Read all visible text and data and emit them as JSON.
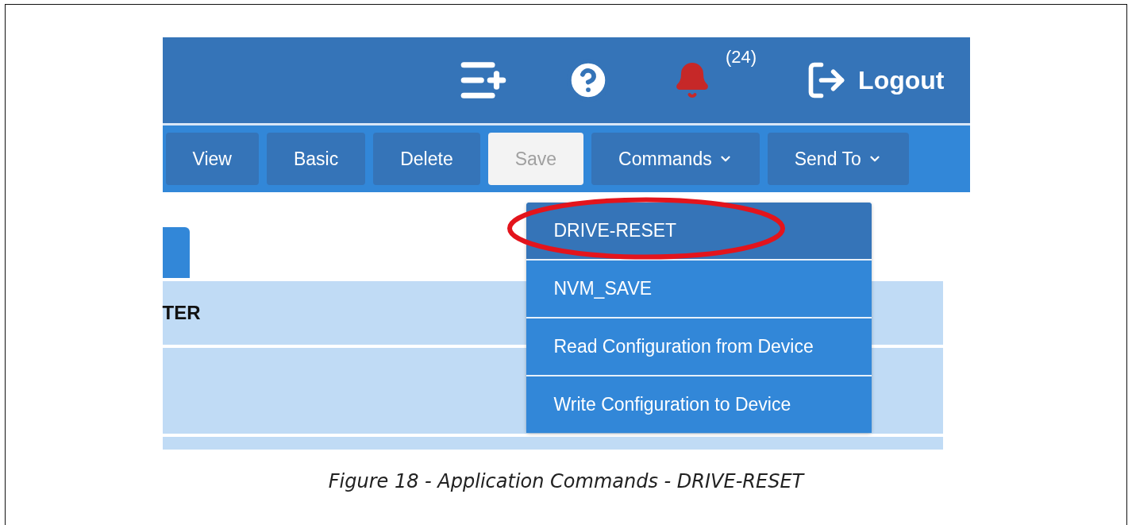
{
  "header": {
    "notification_count": "(24)",
    "logout": "Logout"
  },
  "toolbar": [
    {
      "label": "View",
      "disabled": false,
      "dropdown": false
    },
    {
      "label": "Basic",
      "disabled": false,
      "dropdown": false
    },
    {
      "label": "Delete",
      "disabled": false,
      "dropdown": false
    },
    {
      "label": "Save",
      "disabled": true,
      "dropdown": false
    },
    {
      "label": "Commands",
      "disabled": false,
      "dropdown": true
    },
    {
      "label": "Send To",
      "disabled": false,
      "dropdown": true
    }
  ],
  "commands_menu": [
    {
      "label": "DRIVE-RESET",
      "selected": true,
      "circled": true
    },
    {
      "label": "NVM_SAVE",
      "selected": false,
      "circled": false
    },
    {
      "label": "Read Configuration from Device",
      "selected": false,
      "circled": false
    },
    {
      "label": "Write Configuration to Device",
      "selected": false,
      "circled": false
    }
  ],
  "table": {
    "header_cell": "TER"
  },
  "caption": "Figure 18 - Application Commands - DRIVE-RESET"
}
